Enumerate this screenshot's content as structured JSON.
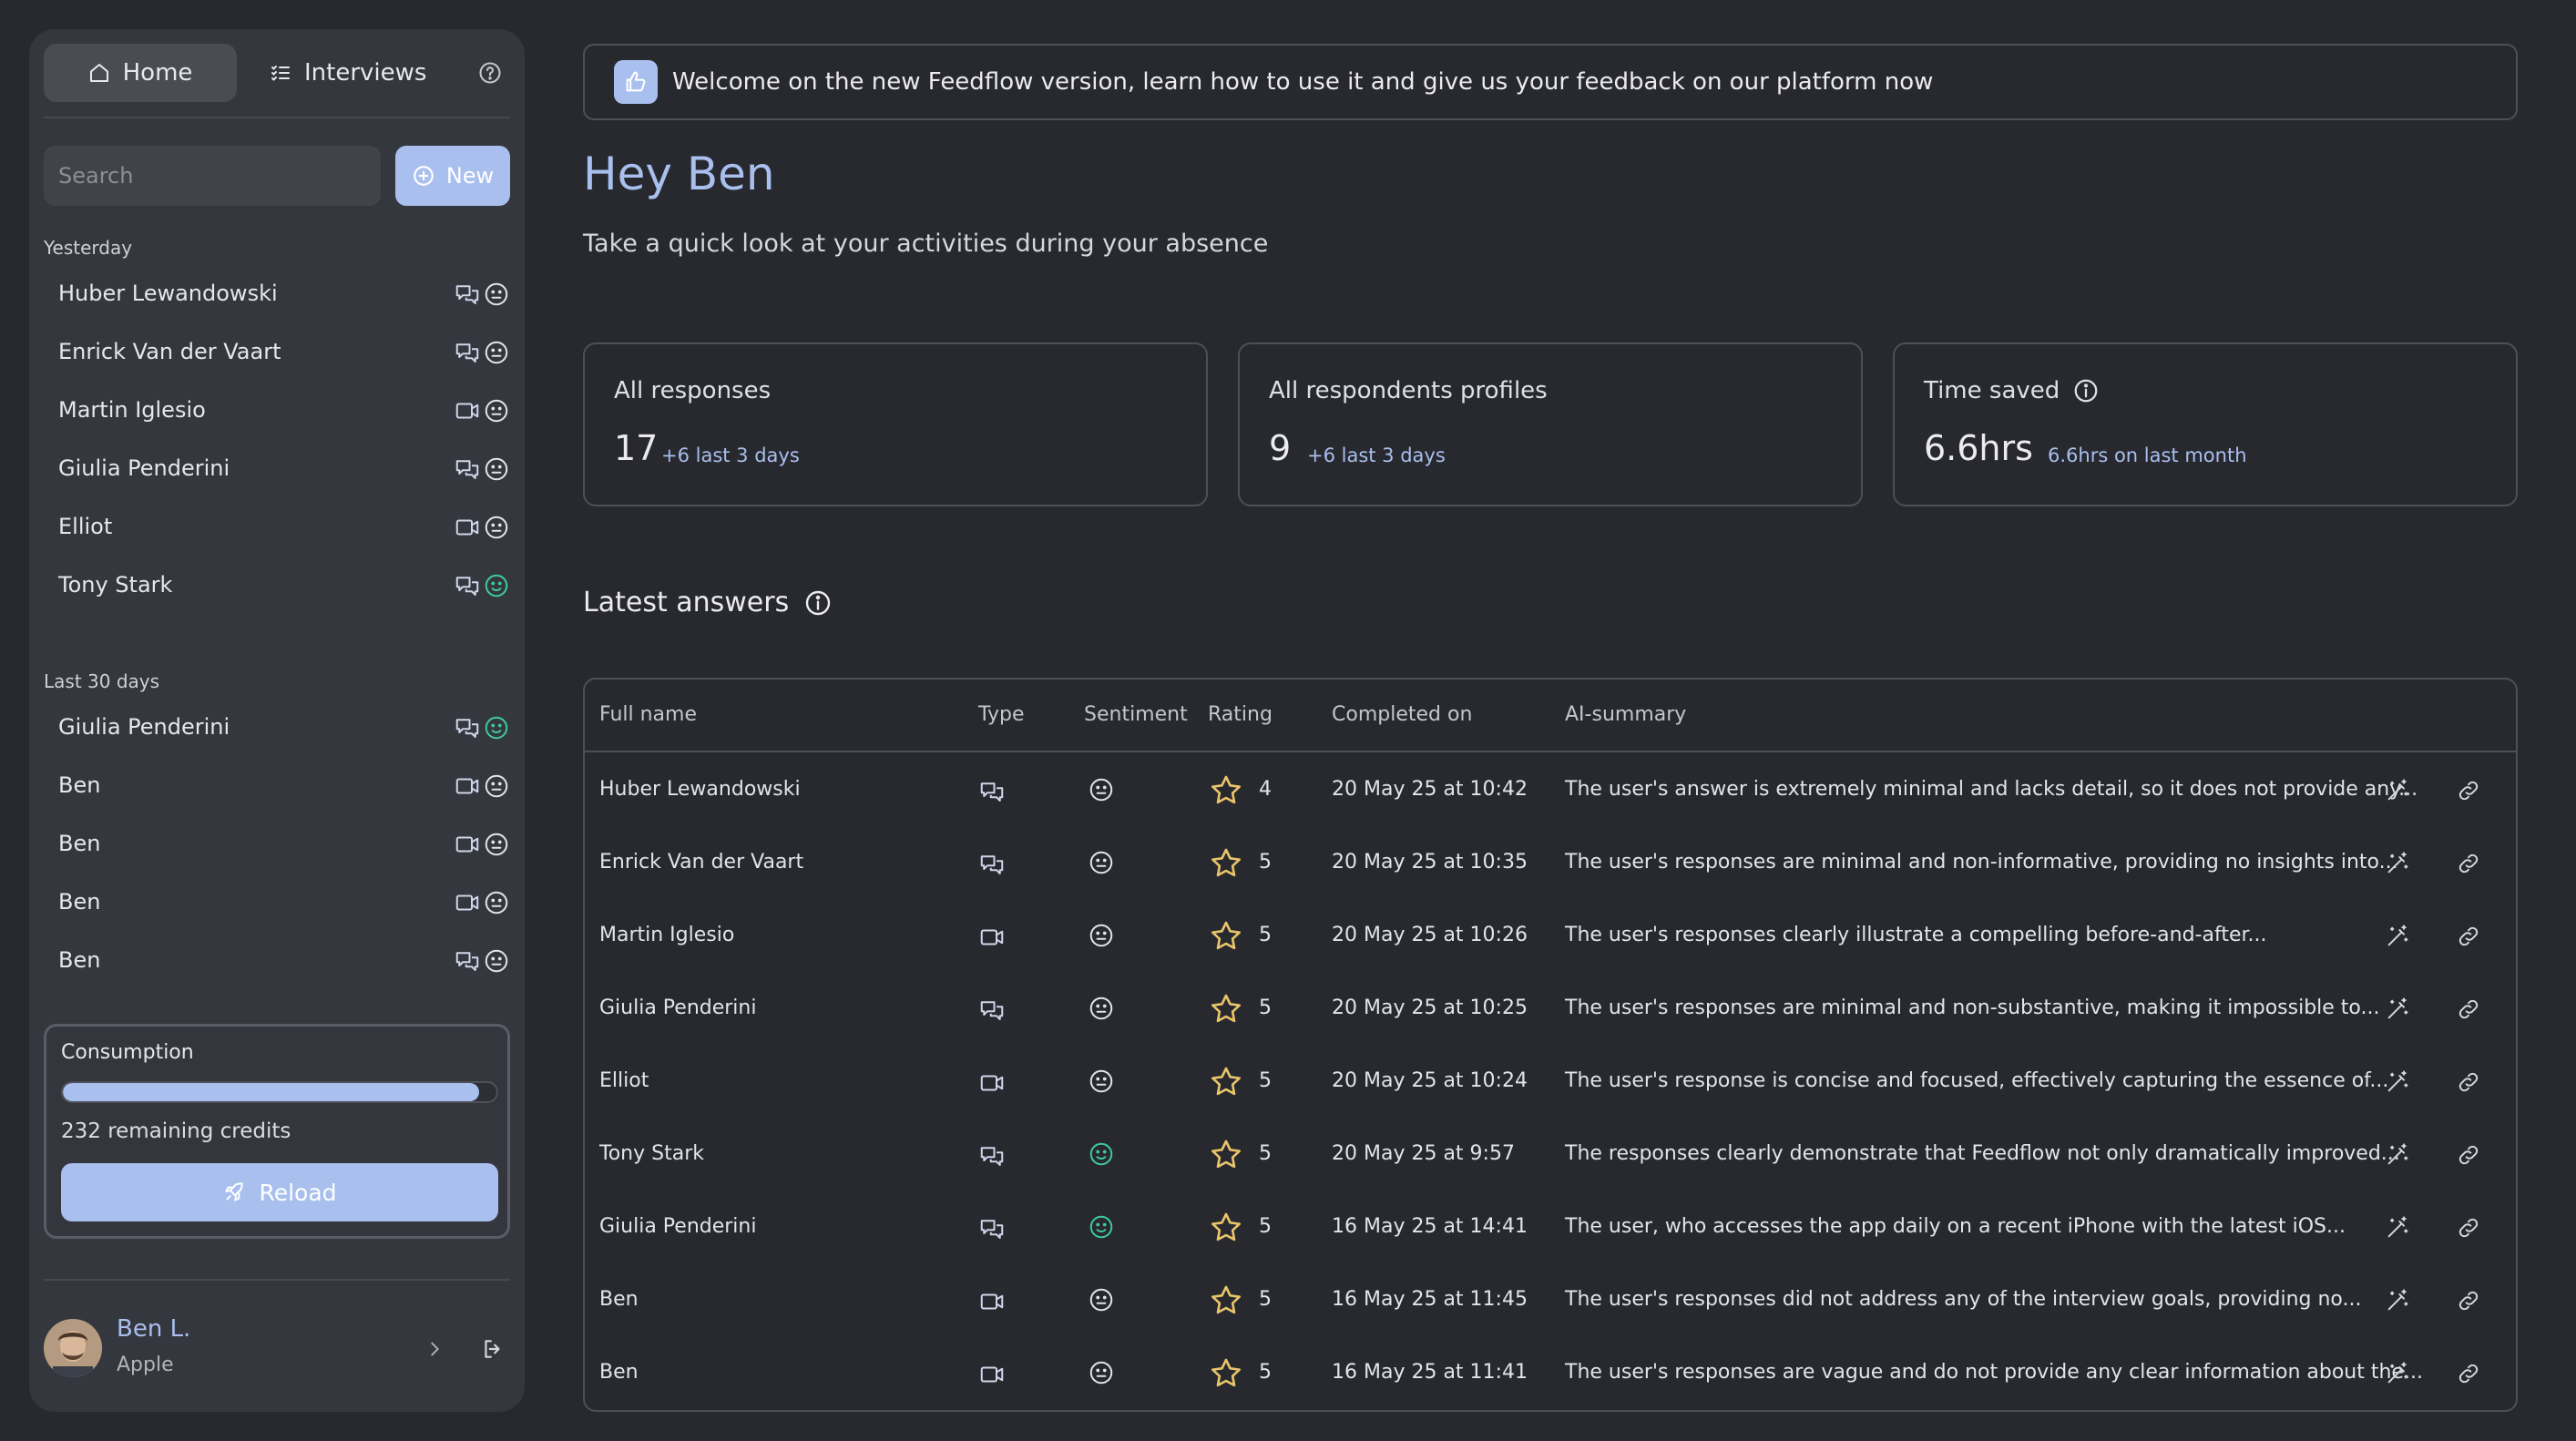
{
  "sidebar": {
    "tabs": {
      "home": "Home",
      "interviews": "Interviews"
    },
    "search_placeholder": "Search",
    "new_label": "New",
    "groups": [
      {
        "label": "Yesterday",
        "items": [
          {
            "name": "Huber Lewandowski",
            "type": "chat",
            "sentiment": "neutral"
          },
          {
            "name": "Enrick Van der Vaart",
            "type": "chat",
            "sentiment": "neutral"
          },
          {
            "name": "Martin Iglesio",
            "type": "video",
            "sentiment": "neutral"
          },
          {
            "name": "Giulia Penderini",
            "type": "chat",
            "sentiment": "neutral"
          },
          {
            "name": "Elliot",
            "type": "video",
            "sentiment": "neutral"
          },
          {
            "name": "Tony Stark",
            "type": "chat",
            "sentiment": "positive"
          }
        ]
      },
      {
        "label": "Last 30 days",
        "items": [
          {
            "name": "Giulia Penderini",
            "type": "chat",
            "sentiment": "positive"
          },
          {
            "name": "Ben",
            "type": "video",
            "sentiment": "neutral"
          },
          {
            "name": "Ben",
            "type": "video",
            "sentiment": "neutral"
          },
          {
            "name": "Ben",
            "type": "video",
            "sentiment": "neutral"
          },
          {
            "name": "Ben",
            "type": "chat",
            "sentiment": "neutral"
          }
        ]
      }
    ],
    "consumption": {
      "title": "Consumption",
      "progress_fraction": 0.96,
      "credits_text": "232 remaining credits",
      "reload_label": "Reload"
    },
    "profile": {
      "name": "Ben L.",
      "org": "Apple"
    }
  },
  "main": {
    "banner": "Welcome on the new Feedflow version, learn how to use it and give us your feedback on our platform now",
    "greeting": "Hey Ben",
    "subtitle": "Take a quick look at your activities during your absence",
    "cards": [
      {
        "label": "All responses",
        "value": "17",
        "delta": "+6 last 3 days"
      },
      {
        "label": "All respondents profiles",
        "value": "9",
        "delta": "+6 last 3 days"
      },
      {
        "label": "Time saved",
        "value": "6.6hrs",
        "delta": "6.6hrs on last month"
      }
    ],
    "section_title": "Latest answers",
    "table": {
      "headers": {
        "name": "Full name",
        "type": "Type",
        "sentiment": "Sentiment",
        "rating": "Rating",
        "completed": "Completed on",
        "summary": "AI-summary"
      },
      "rows": [
        {
          "name": "Huber Lewandowski",
          "type": "chat",
          "sentiment": "neutral",
          "rating": "4",
          "completed": "20 May 25 at 10:42",
          "summary": "The user's answer is extremely minimal and lacks detail, so it does not provide any..."
        },
        {
          "name": "Enrick Van der Vaart",
          "type": "chat",
          "sentiment": "neutral",
          "rating": "5",
          "completed": "20 May 25 at 10:35",
          "summary": "The user's responses are minimal and non-informative, providing no insights into..."
        },
        {
          "name": "Martin Iglesio",
          "type": "video",
          "sentiment": "neutral",
          "rating": "5",
          "completed": "20 May 25 at 10:26",
          "summary": "The user's responses clearly illustrate a compelling before-and-after..."
        },
        {
          "name": "Giulia Penderini",
          "type": "chat",
          "sentiment": "neutral",
          "rating": "5",
          "completed": "20 May 25 at 10:25",
          "summary": "The user's responses are minimal and non-substantive, making it impossible to..."
        },
        {
          "name": "Elliot",
          "type": "video",
          "sentiment": "neutral",
          "rating": "5",
          "completed": "20 May 25 at 10:24",
          "summary": "The user's response is concise and focused, effectively capturing the essence of..."
        },
        {
          "name": "Tony Stark",
          "type": "chat",
          "sentiment": "positive",
          "rating": "5",
          "completed": "20 May 25 at 9:57",
          "summary": "The responses clearly demonstrate that Feedflow not only dramatically improved..."
        },
        {
          "name": "Giulia Penderini",
          "type": "chat",
          "sentiment": "positive",
          "rating": "5",
          "completed": "16 May 25 at 14:41",
          "summary": "The user, who accesses the app daily on a recent iPhone with the latest iOS..."
        },
        {
          "name": "Ben",
          "type": "video",
          "sentiment": "neutral",
          "rating": "5",
          "completed": "16 May 25 at 11:45",
          "summary": "The user's responses did not address any of the interview goals, providing no..."
        },
        {
          "name": "Ben",
          "type": "video",
          "sentiment": "neutral",
          "rating": "5",
          "completed": "16 May 25 at 11:41",
          "summary": "The user's responses are vague and do not provide any clear information about the..."
        }
      ]
    }
  },
  "colors": {
    "background": "#27292f",
    "sidebar": "#35373e",
    "accent": "#a9bfee",
    "positive": "#3ec9a0",
    "star": "#e9c46a",
    "border": "#4d5058"
  }
}
